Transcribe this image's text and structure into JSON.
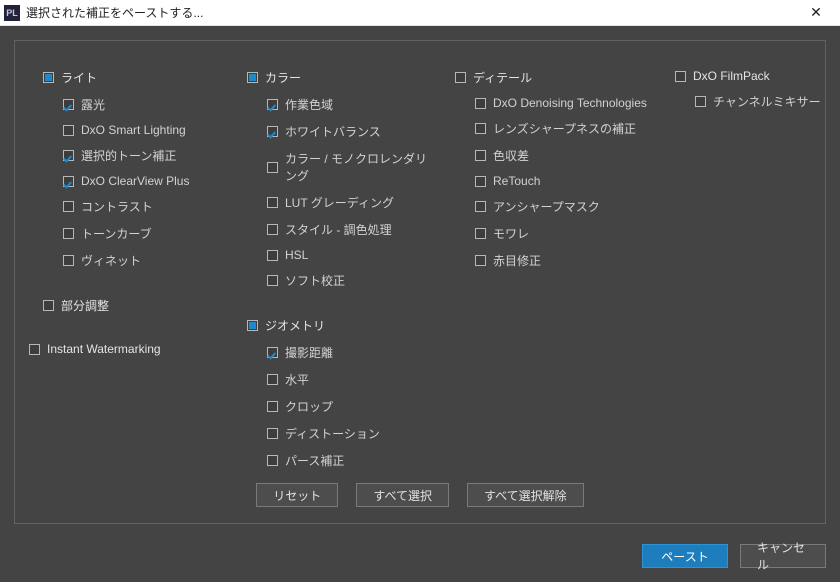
{
  "window": {
    "app_icon_text": "PL",
    "title": "選択された補正をペーストする...",
    "close_glyph": "✕"
  },
  "groups": {
    "light": {
      "label": "ライト",
      "state": "partial"
    },
    "color": {
      "label": "カラー",
      "state": "partial"
    },
    "detail": {
      "label": "ディテール",
      "state": "off"
    },
    "filmpack": {
      "label": "DxO FilmPack",
      "state": "off"
    },
    "local": {
      "label": "部分調整",
      "state": "off"
    },
    "wm": {
      "label": "Instant Watermarking",
      "state": "off"
    },
    "geometry": {
      "label": "ジオメトリ",
      "state": "partial"
    }
  },
  "items": {
    "light": [
      {
        "label": "露光",
        "state": "on"
      },
      {
        "label": "DxO Smart Lighting",
        "state": "off"
      },
      {
        "label": "選択的トーン補正",
        "state": "on"
      },
      {
        "label": "DxO ClearView Plus",
        "state": "on"
      },
      {
        "label": "コントラスト",
        "state": "off"
      },
      {
        "label": "トーンカーブ",
        "state": "off"
      },
      {
        "label": "ヴィネット",
        "state": "off"
      }
    ],
    "color": [
      {
        "label": "作業色域",
        "state": "on"
      },
      {
        "label": "ホワイトバランス",
        "state": "on"
      },
      {
        "label": "カラー / モノクロレンダリング",
        "state": "off"
      },
      {
        "label": "LUT グレーディング",
        "state": "off"
      },
      {
        "label": "スタイル - 調色処理",
        "state": "off"
      },
      {
        "label": "HSL",
        "state": "off"
      },
      {
        "label": "ソフト校正",
        "state": "off"
      }
    ],
    "detail": [
      {
        "label": "DxO Denoising Technologies",
        "state": "off"
      },
      {
        "label": "レンズシャープネスの補正",
        "state": "off"
      },
      {
        "label": "色収差",
        "state": "off"
      },
      {
        "label": "ReTouch",
        "state": "off"
      },
      {
        "label": "アンシャープマスク",
        "state": "off"
      },
      {
        "label": "モワレ",
        "state": "off"
      },
      {
        "label": "赤目修正",
        "state": "off"
      }
    ],
    "filmpack": [
      {
        "label": "チャンネルミキサー",
        "state": "off"
      }
    ],
    "geometry": [
      {
        "label": "撮影距離",
        "state": "on"
      },
      {
        "label": "水平",
        "state": "off"
      },
      {
        "label": "クロップ",
        "state": "off"
      },
      {
        "label": "ディストーション",
        "state": "off"
      },
      {
        "label": "パース補正",
        "state": "off"
      }
    ]
  },
  "buttons": {
    "reset": "リセット",
    "select_all": "すべて選択",
    "deselect_all": "すべて選択解除",
    "paste": "ペースト",
    "cancel": "キャンセル"
  }
}
